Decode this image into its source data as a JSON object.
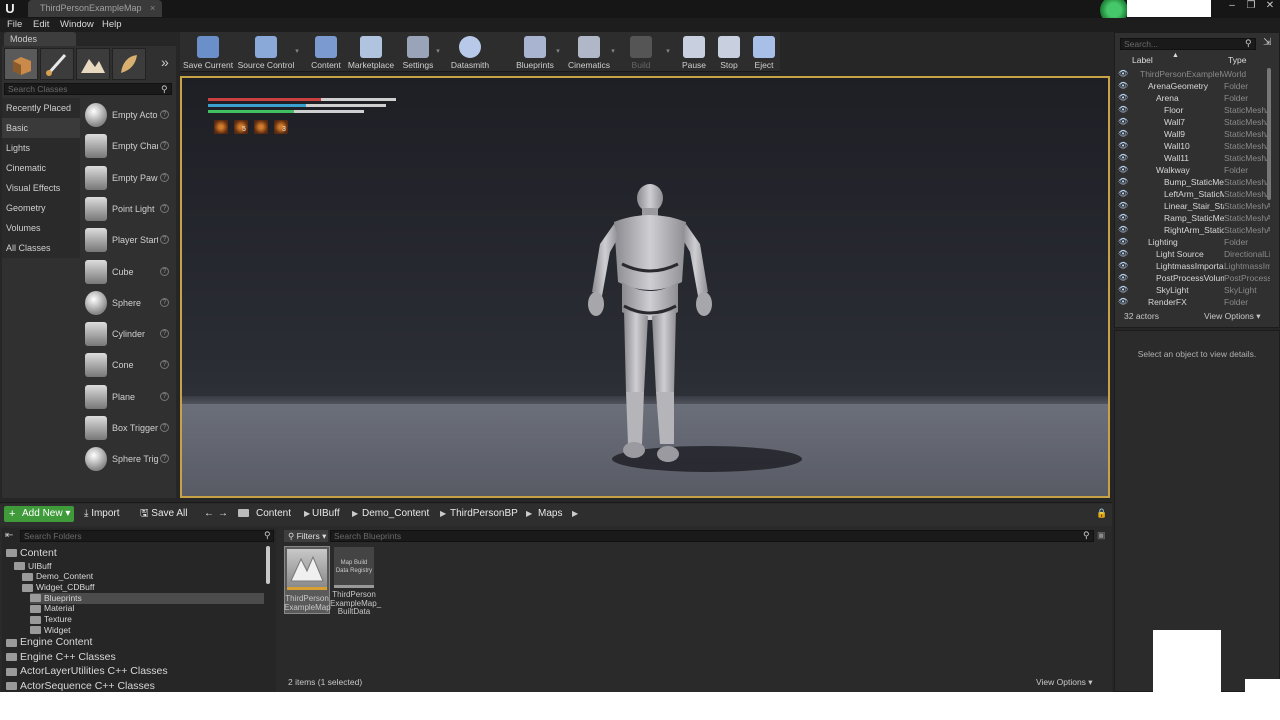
{
  "window": {
    "document_tab": "ThirdPersonExampleMap",
    "tab_close": "×",
    "logo": "U",
    "controls": [
      "–",
      "❐",
      "✕"
    ]
  },
  "menu": [
    "File",
    "Edit",
    "Window",
    "Help"
  ],
  "modes": {
    "tab_label": "Modes",
    "search_placeholder": "Search Classes",
    "more": "»",
    "categories": [
      "Recently Placed",
      "Basic",
      "Lights",
      "Cinematic",
      "Visual Effects",
      "Geometry",
      "Volumes",
      "All Classes"
    ],
    "active_category": "Basic",
    "classes": [
      "Empty Actor",
      "Empty Character",
      "Empty Pawn",
      "Point Light",
      "Player Start",
      "Cube",
      "Sphere",
      "Cylinder",
      "Cone",
      "Plane",
      "Box Trigger",
      "Sphere Trigger"
    ],
    "help_glyph": "?"
  },
  "toolbar": {
    "buttons": [
      "Save Current",
      "Source Control",
      "Content",
      "Marketplace",
      "Settings",
      "Datasmith",
      "Blueprints",
      "Cinematics",
      "Build",
      "Pause",
      "Stop",
      "Eject"
    ],
    "dropdown_glyph": "▾"
  },
  "hud": {
    "bars": [
      {
        "color": "#c94040",
        "fill": 0.6
      },
      {
        "color": "#3aa0d0",
        "fill": 0.55
      },
      {
        "color": "#40c060",
        "fill": 0.55
      }
    ],
    "counts": [
      "5",
      "3"
    ]
  },
  "outliner": {
    "search_placeholder": "Search...",
    "col_label": "Label",
    "col_type": "Type",
    "rows": [
      {
        "label": "ThirdPersonExampleMap",
        "type": "World",
        "indent": 0,
        "dim": true
      },
      {
        "label": "ArenaGeometry",
        "type": "Folder",
        "indent": 1
      },
      {
        "label": "Arena",
        "type": "Folder",
        "indent": 2
      },
      {
        "label": "Floor",
        "type": "StaticMeshActor",
        "indent": 3
      },
      {
        "label": "Wall7",
        "type": "StaticMeshActor",
        "indent": 3
      },
      {
        "label": "Wall9",
        "type": "StaticMeshActor",
        "indent": 3
      },
      {
        "label": "Wall10",
        "type": "StaticMeshActor",
        "indent": 3
      },
      {
        "label": "Wall11",
        "type": "StaticMeshActor",
        "indent": 3
      },
      {
        "label": "Walkway",
        "type": "Folder",
        "indent": 2
      },
      {
        "label": "Bump_StaticMesh",
        "type": "StaticMeshActor",
        "indent": 3
      },
      {
        "label": "LeftArm_StaticMesh",
        "type": "StaticMeshActor",
        "indent": 3
      },
      {
        "label": "Linear_Stair_StaticMesh",
        "type": "StaticMeshActor",
        "indent": 3
      },
      {
        "label": "Ramp_StaticMesh",
        "type": "StaticMeshActor",
        "indent": 3
      },
      {
        "label": "RightArm_StaticMesh",
        "type": "StaticMeshActor",
        "indent": 3
      },
      {
        "label": "Lighting",
        "type": "Folder",
        "indent": 1
      },
      {
        "label": "Light Source",
        "type": "DirectionalLight",
        "indent": 2
      },
      {
        "label": "LightmassImportanceVolume",
        "type": "LightmassImportanceVolume",
        "indent": 2
      },
      {
        "label": "PostProcessVolume",
        "type": "PostProcessVolume",
        "indent": 2
      },
      {
        "label": "SkyLight",
        "type": "SkyLight",
        "indent": 2
      },
      {
        "label": "RenderFX",
        "type": "Folder",
        "indent": 1
      }
    ],
    "actor_count": "32 actors",
    "view_options": "View Options ▾",
    "eye_glyph": "👁"
  },
  "details": {
    "hint": "Select an object to view details."
  },
  "content_browser": {
    "add_new": "Add New ▾",
    "add_plus": "+",
    "import": "⤓ Import",
    "save_all": "🖫 Save All",
    "back": "←",
    "forward": "→",
    "breadcrumbs": [
      "Content",
      "UIBuff",
      "Demo_Content",
      "ThirdPersonBP",
      "Maps"
    ],
    "crumb_sep": "▶",
    "lock": "🔒",
    "search_folders_placeholder": "Search Folders",
    "tree": [
      {
        "label": "Content",
        "indent": 0,
        "big": true
      },
      {
        "label": "UIBuff",
        "indent": 1
      },
      {
        "label": "Demo_Content",
        "indent": 2
      },
      {
        "label": "Widget_CDBuff",
        "indent": 2
      },
      {
        "label": "Blueprints",
        "indent": 3,
        "selected": true
      },
      {
        "label": "Material",
        "indent": 3
      },
      {
        "label": "Texture",
        "indent": 3
      },
      {
        "label": "Widget",
        "indent": 3
      },
      {
        "label": "Engine Content",
        "indent": 0,
        "big": true
      },
      {
        "label": "Engine C++ Classes",
        "indent": 0,
        "big": true
      },
      {
        "label": "ActorLayerUtilities C++ Classes",
        "indent": 0,
        "big": true
      },
      {
        "label": "ActorSequence C++ Classes",
        "indent": 0,
        "big": true
      }
    ],
    "filters": "⚲ Filters ▾",
    "search_placeholder": "Search Blueprints",
    "assets": [
      {
        "label": "ThirdPerson ExampleMap",
        "selected": true
      },
      {
        "label": "ThirdPerson ExampleMap_ BuiltData",
        "thumb_text": "Map Build Data Registry"
      }
    ],
    "item_count": "2 items (1 selected)",
    "view_options": "View Options ▾"
  }
}
